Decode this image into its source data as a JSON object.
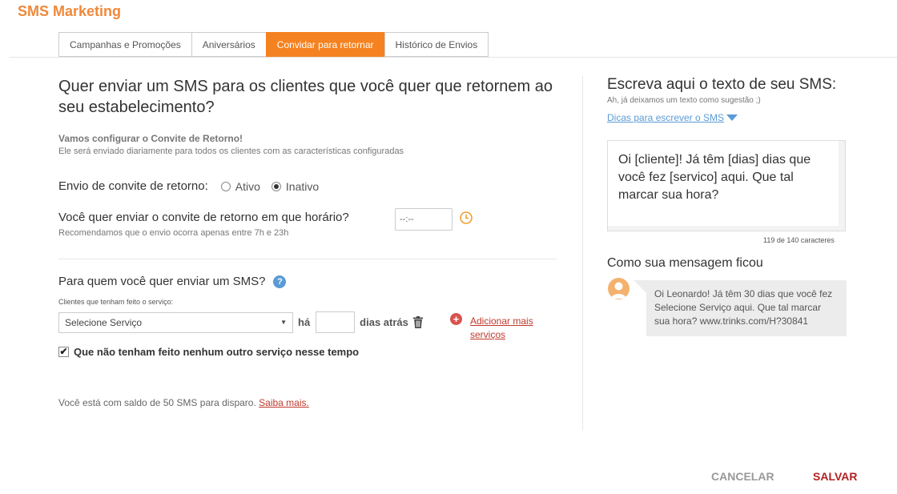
{
  "app": {
    "title": "SMS Marketing"
  },
  "tabs": [
    {
      "label": "Campanhas e Promoções",
      "active": false
    },
    {
      "label": "Aniversários",
      "active": false
    },
    {
      "label": "Convidar para retornar",
      "active": true
    },
    {
      "label": "Histórico de Envios",
      "active": false
    }
  ],
  "left": {
    "question": "Quer enviar um SMS para os clientes que você quer que retornem ao seu estabelecimento?",
    "config_title": "Vamos configurar o Convite de Retorno!",
    "config_desc": "Ele será enviado diariamente para todos os clientes com as características configuradas",
    "envio_label": "Envio de convite de retorno:",
    "radio_ativo": "Ativo",
    "radio_inativo": "Inativo",
    "selected_status": "Inativo",
    "horario_question": "Você quer enviar o convite de retorno em que horário?",
    "horario_placeholder": "--:--",
    "horario_hint": "Recomendamos que o envio ocorra apenas entre 7h e 23h",
    "para_quem": "Para quem você quer enviar um SMS?",
    "help_symbol": "?",
    "clientes_label": "Clientes que tenham feito o serviço:",
    "servico_select": "Selecione Serviço",
    "ha_label": "há",
    "dias_label": "dias atrás",
    "add_symbol": "+",
    "add_link": "Adicionar mais serviços",
    "checkbox_label": "Que não tenham feito nenhum outro serviço nesse tempo",
    "checkbox_checked": true,
    "checkbox_mark": "✔",
    "saldo_text": "Você está com saldo de 50 SMS para disparo.",
    "saldo_link": "Saiba mais."
  },
  "right": {
    "title": "Escreva aqui o texto de seu SMS:",
    "subtitle": "Ah, já deixamos um texto como sugestão ;)",
    "tips_link": "Dicas para escrever o SMS",
    "sms_text": "Oi [cliente]! Já têm [dias] dias que você fez [servico] aqui. Que tal marcar sua hora?",
    "char_count": "119 de 140 caracteres",
    "preview_title": "Como sua mensagem ficou",
    "preview_text": "Oi Leonardo! Já têm 30 dias que você fez Selecione Serviço aqui. Que tal marcar sua hora? www.trinks.com/H?30841"
  },
  "footer": {
    "cancel": "CANCELAR",
    "save": "SALVAR"
  },
  "colors": {
    "brand": "#f58220",
    "link": "#c0392b",
    "info": "#5b9bd5",
    "save": "#b22222"
  }
}
